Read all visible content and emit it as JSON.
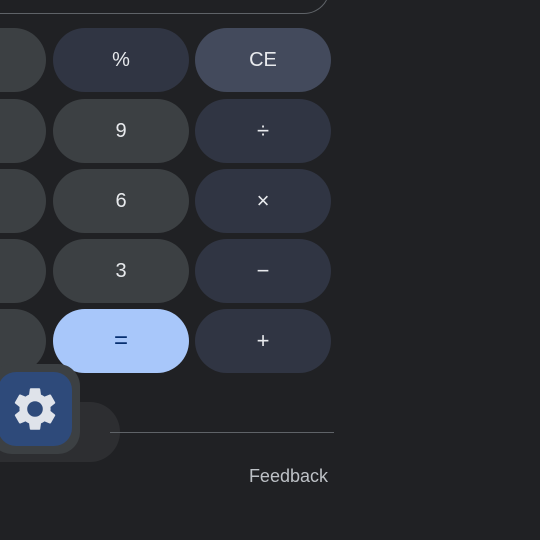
{
  "keypad": {
    "row1": {
      "percent": "%",
      "clear_entry": "CE"
    },
    "row2": {
      "nine": "9",
      "divide": "÷"
    },
    "row3": {
      "six": "6",
      "multiply": "×"
    },
    "row4": {
      "three": "3",
      "minus": "−"
    },
    "row5": {
      "equals": "=",
      "plus": "+"
    }
  },
  "footer": {
    "feedback_label": "Feedback"
  },
  "icons": {
    "settings": "gear-icon"
  },
  "colors": {
    "background": "#202124",
    "number_key": "#3c4043",
    "operator_key": "#303543",
    "equals_key": "#a8c7fa",
    "settings_accent": "#2e4a7a"
  }
}
